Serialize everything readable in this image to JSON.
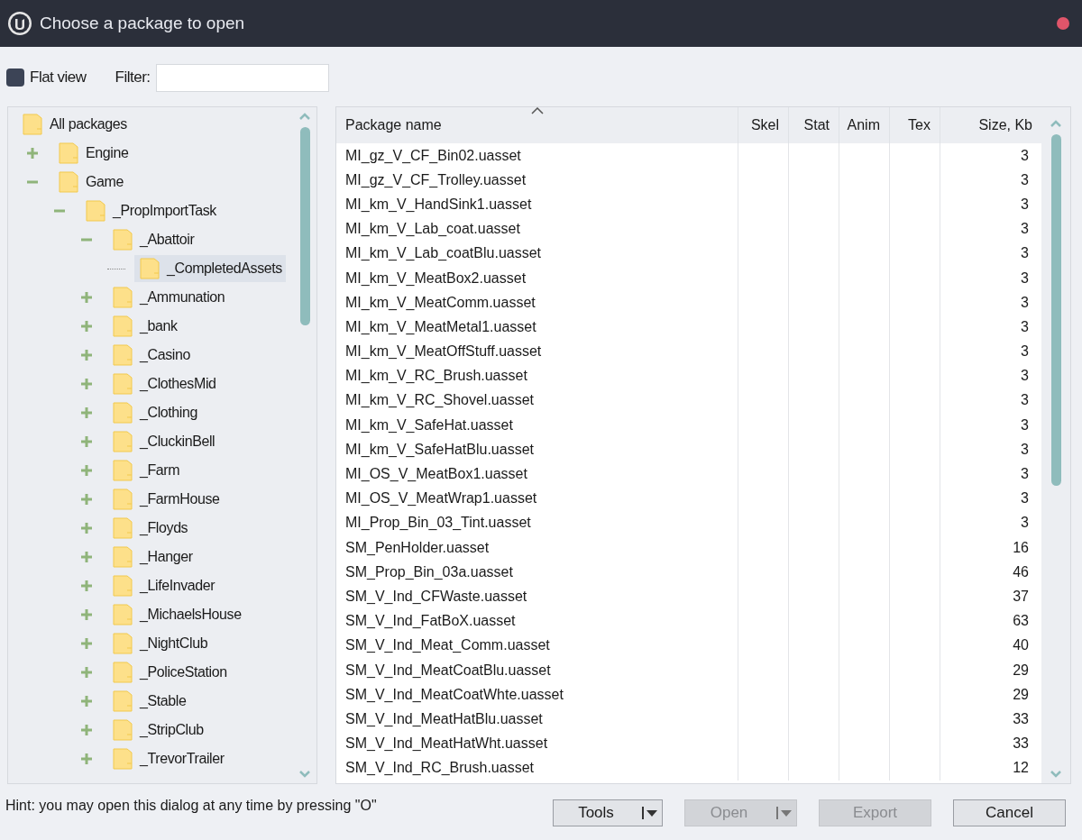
{
  "window": {
    "title": "Choose a package to open"
  },
  "toolbar": {
    "flat_view": {
      "label": "Flat view",
      "checked": false
    },
    "filter": {
      "label": "Filter:"
    }
  },
  "tree": [
    {
      "label": "All packages",
      "selected": false,
      "children": [
        {
          "label": "Engine",
          "selected": false,
          "expanded": false
        },
        {
          "label": "Game",
          "selected": false,
          "expanded": true,
          "children": [
            {
              "label": "_PropImportTask",
              "selected": false,
              "expanded": true,
              "children": [
                {
                  "label": "_Abattoir",
                  "selected": false,
                  "expanded": true,
                  "children": [
                    {
                      "label": "_CompletedAssets",
                      "selected": true
                    }
                  ]
                },
                {
                  "label": "_Ammunation",
                  "selected": false,
                  "expanded": false
                },
                {
                  "label": "_bank",
                  "selected": false,
                  "expanded": false
                },
                {
                  "label": "_Casino",
                  "selected": false,
                  "expanded": false
                },
                {
                  "label": "_ClothesMid",
                  "selected": false,
                  "expanded": false
                },
                {
                  "label": "_Clothing",
                  "selected": false,
                  "expanded": false
                },
                {
                  "label": "_CluckinBell",
                  "selected": false,
                  "expanded": false
                },
                {
                  "label": "_Farm",
                  "selected": false,
                  "expanded": false
                },
                {
                  "label": "_FarmHouse",
                  "selected": false,
                  "expanded": false
                },
                {
                  "label": "_Floyds",
                  "selected": false,
                  "expanded": false
                },
                {
                  "label": "_Hanger",
                  "selected": false,
                  "expanded": false
                },
                {
                  "label": "_LifeInvader",
                  "selected": false,
                  "expanded": false
                },
                {
                  "label": "_MichaelsHouse",
                  "selected": false,
                  "expanded": false
                },
                {
                  "label": "_NightClub",
                  "selected": false,
                  "expanded": false
                },
                {
                  "label": "_PoliceStation",
                  "selected": false,
                  "expanded": false
                },
                {
                  "label": "_Stable",
                  "selected": false,
                  "expanded": false
                },
                {
                  "label": "_StripClub",
                  "selected": false,
                  "expanded": false
                },
                {
                  "label": "_TrevorTrailer",
                  "selected": false,
                  "expanded": false
                }
              ]
            }
          ]
        }
      ]
    }
  ],
  "table": {
    "columns": [
      "Package name",
      "Skel",
      "Stat",
      "Anim",
      "Tex",
      "Size, Kb"
    ],
    "rows": [
      {
        "name": "MI_gz_V_CF_Bin02.uasset",
        "size": "3"
      },
      {
        "name": "MI_gz_V_CF_Trolley.uasset",
        "size": "3"
      },
      {
        "name": "MI_km_V_HandSink1.uasset",
        "size": "3"
      },
      {
        "name": "MI_km_V_Lab_coat.uasset",
        "size": "3"
      },
      {
        "name": "MI_km_V_Lab_coatBlu.uasset",
        "size": "3"
      },
      {
        "name": "MI_km_V_MeatBox2.uasset",
        "size": "3"
      },
      {
        "name": "MI_km_V_MeatComm.uasset",
        "size": "3"
      },
      {
        "name": "MI_km_V_MeatMetal1.uasset",
        "size": "3"
      },
      {
        "name": "MI_km_V_MeatOffStuff.uasset",
        "size": "3"
      },
      {
        "name": "MI_km_V_RC_Brush.uasset",
        "size": "3"
      },
      {
        "name": "MI_km_V_RC_Shovel.uasset",
        "size": "3"
      },
      {
        "name": "MI_km_V_SafeHat.uasset",
        "size": "3"
      },
      {
        "name": "MI_km_V_SafeHatBlu.uasset",
        "size": "3"
      },
      {
        "name": "MI_OS_V_MeatBox1.uasset",
        "size": "3"
      },
      {
        "name": "MI_OS_V_MeatWrap1.uasset",
        "size": "3"
      },
      {
        "name": "MI_Prop_Bin_03_Tint.uasset",
        "size": "3"
      },
      {
        "name": "SM_PenHolder.uasset",
        "size": "16"
      },
      {
        "name": "SM_Prop_Bin_03a.uasset",
        "size": "46"
      },
      {
        "name": "SM_V_Ind_CFWaste.uasset",
        "size": "37"
      },
      {
        "name": "SM_V_Ind_FatBoX.uasset",
        "size": "63"
      },
      {
        "name": "SM_V_Ind_Meat_Comm.uasset",
        "size": "40"
      },
      {
        "name": "SM_V_Ind_MeatCoatBlu.uasset",
        "size": "29"
      },
      {
        "name": "SM_V_Ind_MeatCoatWhte.uasset",
        "size": "29"
      },
      {
        "name": "SM_V_Ind_MeatHatBlu.uasset",
        "size": "33"
      },
      {
        "name": "SM_V_Ind_MeatHatWht.uasset",
        "size": "33"
      },
      {
        "name": "SM_V_Ind_RC_Brush.uasset",
        "size": "12"
      }
    ]
  },
  "hint": "Hint: you may open this dialog at any time by pressing \"O\"",
  "buttons": [
    {
      "label": "Tools",
      "disabled": false,
      "dropdown": true
    },
    {
      "label": "Open",
      "disabled": true,
      "dropdown": true
    },
    {
      "label": "Export",
      "disabled": true,
      "dropdown": false
    },
    {
      "label": "Cancel",
      "disabled": false,
      "dropdown": false
    }
  ]
}
